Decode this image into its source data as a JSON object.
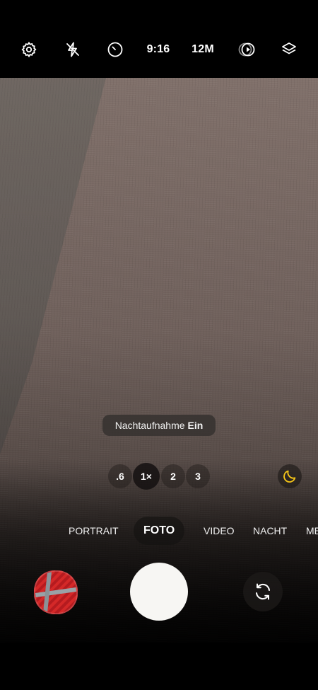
{
  "topbar": {
    "timer_ratio": "9:16",
    "resolution": "12M",
    "icons": [
      "gear-icon",
      "flash-off-icon",
      "timer-icon",
      "motion-photo-icon",
      "filters-icon"
    ]
  },
  "toast": {
    "prefix": "Nachtaufnahme",
    "state": "Ein"
  },
  "zoom": {
    "options": [
      ".6",
      "1×",
      "2",
      "3"
    ],
    "selected": "1×"
  },
  "night_mode_icon": "moon-icon",
  "accent_color": "#f5c518",
  "modes": {
    "items": [
      "PORTRAIT",
      "FOTO",
      "VIDEO",
      "NACHT",
      "ME"
    ],
    "selected": "FOTO"
  }
}
